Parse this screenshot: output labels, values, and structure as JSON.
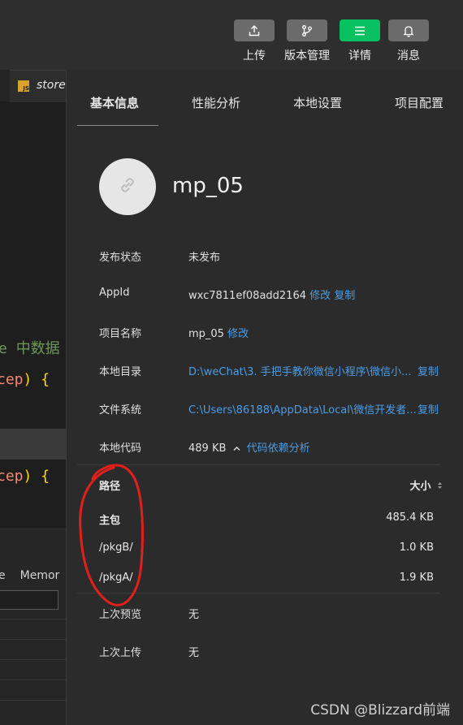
{
  "toolbar": {
    "buttons": [
      {
        "label": "上传",
        "icon": "upload-icon",
        "active": false
      },
      {
        "label": "版本管理",
        "icon": "branch-icon",
        "active": false
      },
      {
        "label": "详情",
        "icon": "menu-icon",
        "active": true
      },
      {
        "label": "消息",
        "icon": "bell-icon",
        "active": false
      }
    ]
  },
  "editor": {
    "tab_icon_text": "JS",
    "tab_filename": "store",
    "code_fragments": {
      "line1_keyword": "e",
      "line1_text": "中数据",
      "line2_param": "cep",
      "line2_close": ") {",
      "line3_param": "cep",
      "line3_close": ") {"
    },
    "panel_tabs": [
      "e",
      "Memor"
    ]
  },
  "detail": {
    "tabs": [
      "基本信息",
      "性能分析",
      "本地设置",
      "项目配置"
    ],
    "active_tab": "基本信息",
    "project_name": "mp_05",
    "fields": {
      "status_label": "发布状态",
      "status_value": "未发布",
      "appid_label": "AppId",
      "appid_value": "wxc7811ef08add2164",
      "appid_edit": "修改",
      "appid_copy": "复制",
      "name_label": "项目名称",
      "name_value": "mp_05",
      "name_edit": "修改",
      "dir_label": "本地目录",
      "dir_value": "D:\\weChat\\3. 手把手教你微信小程序\\微信小...",
      "dir_copy": "复制",
      "fs_label": "文件系统",
      "fs_value": "C:\\Users\\86188\\AppData\\Local\\微信开发者...",
      "fs_copy": "复制",
      "code_label": "本地代码",
      "code_size": "489 KB",
      "code_link": "代码依赖分析"
    },
    "packages": {
      "header_path": "路径",
      "header_size": "大小",
      "rows": [
        {
          "path": "主包",
          "size": "485.4 KB"
        },
        {
          "path": "/pkgB/",
          "size": "1.0 KB"
        },
        {
          "path": "/pkgA/",
          "size": "1.9 KB"
        }
      ]
    },
    "preview_label": "上次预览",
    "preview_value": "无",
    "upload_label": "上次上传",
    "upload_value": "无"
  },
  "watermark": "CSDN @Blizzard前端",
  "colors": {
    "accent_green": "#07c160",
    "link_blue": "#4a9de8",
    "annotation_red": "#e0201a"
  }
}
